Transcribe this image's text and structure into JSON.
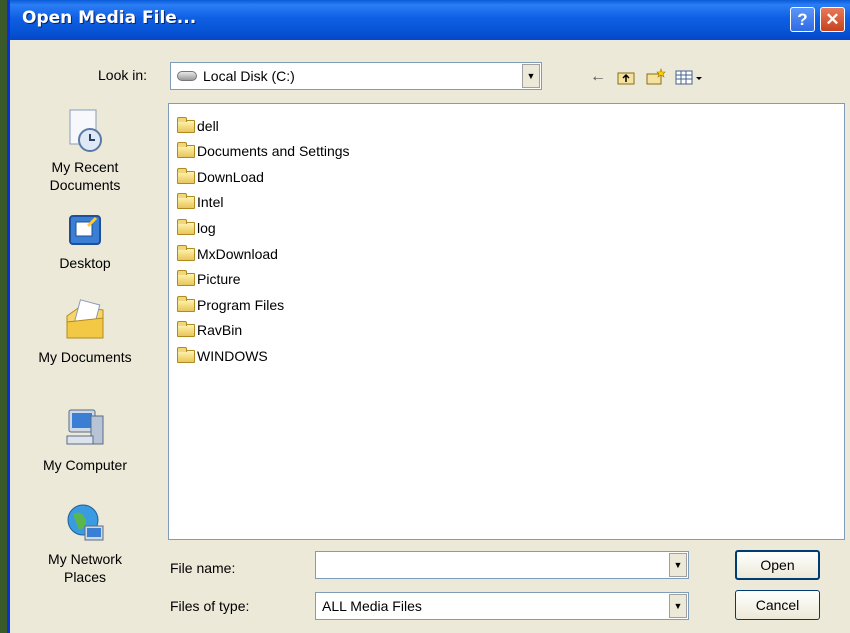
{
  "window": {
    "title": "Open Media File...",
    "help_label": "?",
    "close_label": "✕"
  },
  "lookin": {
    "label": "Look in:",
    "value": "Local Disk (C:)"
  },
  "places": [
    {
      "lines": [
        "My Recent",
        "Documents"
      ],
      "icon": "recent-documents-icon"
    },
    {
      "lines": [
        "Desktop"
      ],
      "icon": "desktop-icon"
    },
    {
      "lines": [
        "My Documents"
      ],
      "icon": "my-documents-icon"
    },
    {
      "lines": [
        "My Computer"
      ],
      "icon": "my-computer-icon"
    },
    {
      "lines": [
        "My Network",
        "Places"
      ],
      "icon": "network-places-icon"
    }
  ],
  "files": [
    "dell",
    "Documents and Settings",
    "DownLoad",
    "Intel",
    "log",
    "MxDownload",
    "Picture",
    "Program Files",
    "RavBin",
    "WINDOWS"
  ],
  "filename": {
    "label": "File name:",
    "value": ""
  },
  "filetype": {
    "label": "Files of type:",
    "value": "ALL Media Files"
  },
  "buttons": {
    "open": "Open",
    "cancel": "Cancel"
  }
}
